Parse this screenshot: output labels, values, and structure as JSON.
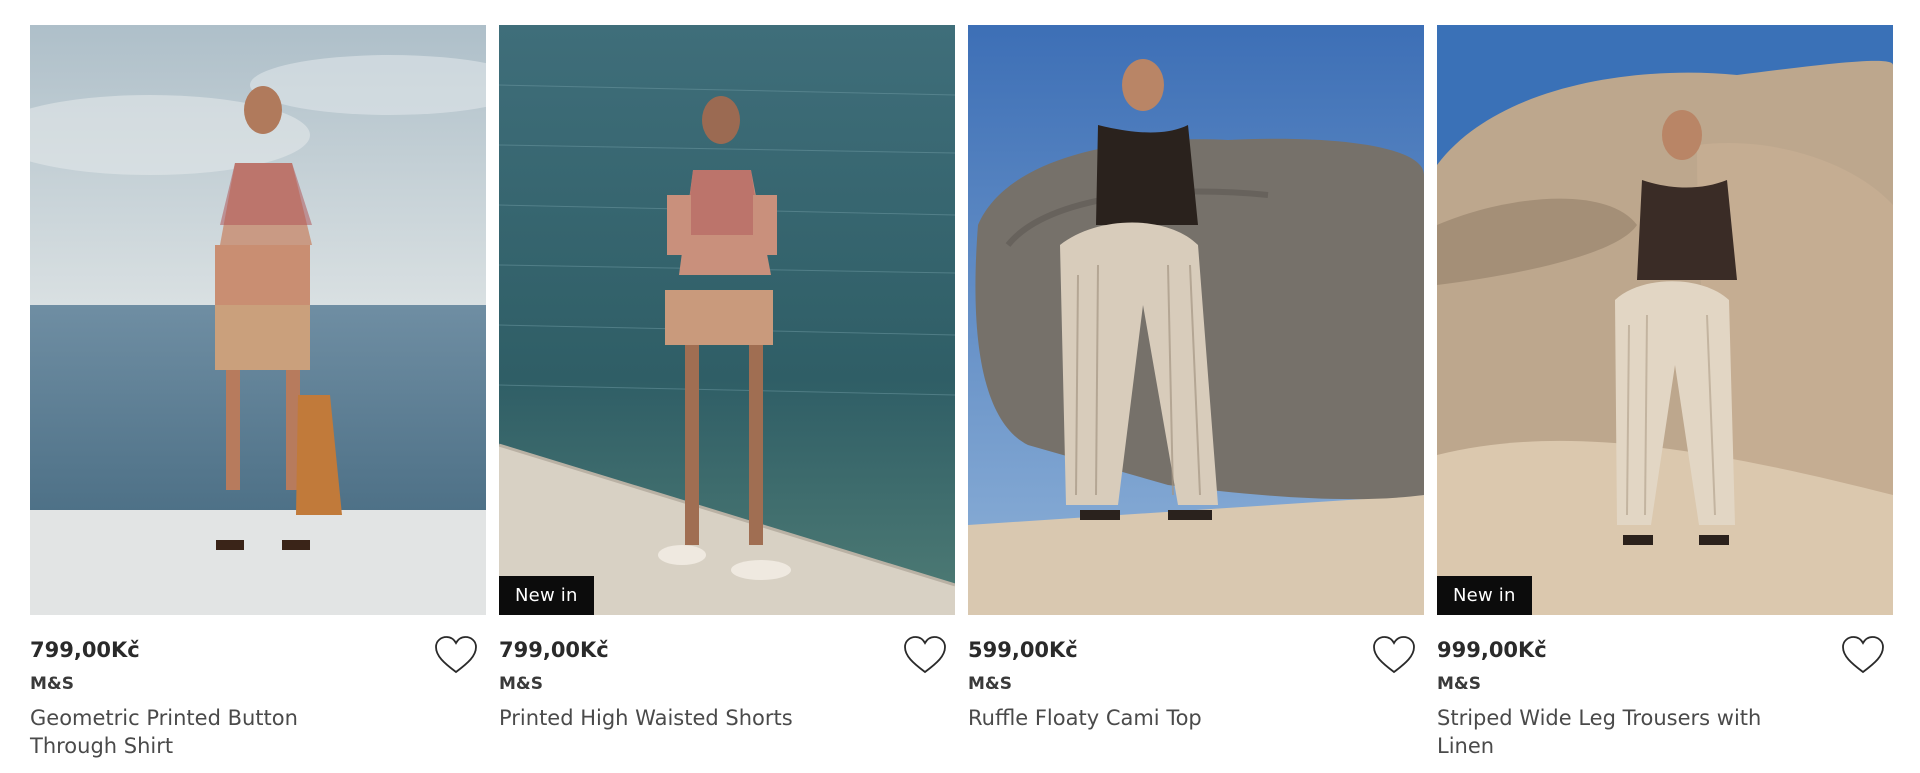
{
  "products": [
    {
      "price": "799,00Kč",
      "brand": "M&S",
      "name": "Geometric Printed Button Through Shirt",
      "badge": "",
      "image": "model-in-printed-shirt-by-sea"
    },
    {
      "price": "799,00Kč",
      "brand": "M&S",
      "name": "Printed High Waisted Shorts",
      "badge": "New in",
      "image": "model-in-printed-shorts-on-pier"
    },
    {
      "price": "599,00Kč",
      "brand": "M&S",
      "name": "Ruffle Floaty Cami Top",
      "badge": "",
      "image": "model-in-cami-top-by-rock"
    },
    {
      "price": "999,00Kč",
      "brand": "M&S",
      "name": "Striped Wide Leg Trousers with Linen",
      "badge": "New in",
      "image": "model-in-wide-leg-trousers-on-rocks"
    }
  ],
  "icons": {
    "wishlist": "heart-outline-icon"
  }
}
